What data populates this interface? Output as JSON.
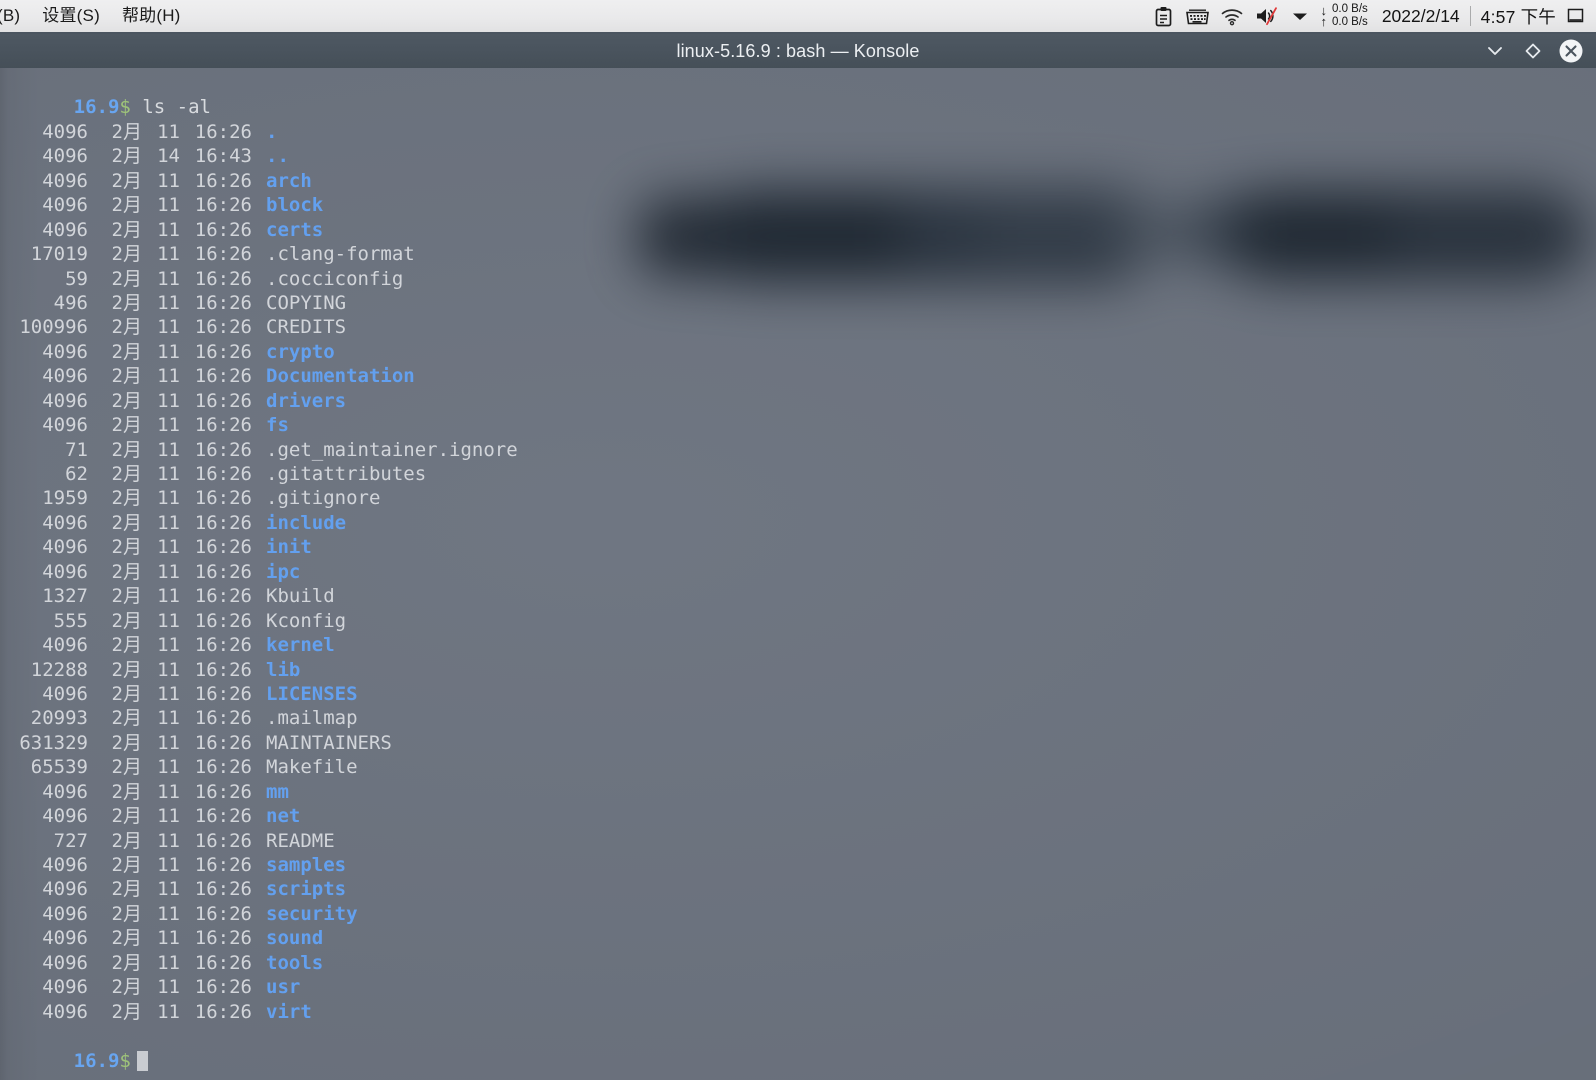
{
  "panel": {
    "menu_items": [
      {
        "label": "(B)",
        "name": "menu-bookmarks"
      },
      {
        "label": "设置(S)",
        "name": "menu-settings"
      },
      {
        "label": "帮助(H)",
        "name": "menu-help"
      }
    ],
    "tray_icons": [
      {
        "name": "clipboard-icon"
      },
      {
        "name": "keyboard-icon"
      },
      {
        "name": "wifi-icon"
      },
      {
        "name": "volume-muted-icon"
      },
      {
        "name": "chevron-down-icon"
      }
    ],
    "network": {
      "download_label": "0.0 B/s",
      "upload_label": "0.0 B/s",
      "down_arrow": "↓",
      "up_arrow": "↑"
    },
    "clock": {
      "date": "2022/2/14",
      "time": "4:57 下午"
    },
    "show_desktop_name": "show-desktop-icon"
  },
  "window": {
    "title": "linux-5.16.9 : bash — Konsole",
    "buttons": [
      {
        "name": "minimize-button",
        "glyph": "⌄"
      },
      {
        "name": "maximize-button",
        "glyph": "◇"
      },
      {
        "name": "close-button",
        "glyph": "✕"
      }
    ]
  },
  "terminal": {
    "prompt_host": "16.9",
    "prompt_symbol": "$",
    "command": "ls -al",
    "colors": {
      "background": "#6c737f",
      "foreground": "#d2d5da",
      "directory": "#63a0ef",
      "host": "#68a5f0",
      "dollar": "#9ec37a"
    },
    "listing": [
      {
        "size": "4096",
        "month": "2月",
        "day": "11",
        "time": "16:26",
        "name": ".",
        "type": "dir"
      },
      {
        "size": "4096",
        "month": "2月",
        "day": "14",
        "time": "16:43",
        "name": "..",
        "type": "dir"
      },
      {
        "size": "4096",
        "month": "2月",
        "day": "11",
        "time": "16:26",
        "name": "arch",
        "type": "dir"
      },
      {
        "size": "4096",
        "month": "2月",
        "day": "11",
        "time": "16:26",
        "name": "block",
        "type": "dir"
      },
      {
        "size": "4096",
        "month": "2月",
        "day": "11",
        "time": "16:26",
        "name": "certs",
        "type": "dir"
      },
      {
        "size": "17019",
        "month": "2月",
        "day": "11",
        "time": "16:26",
        "name": ".clang-format",
        "type": "file"
      },
      {
        "size": "59",
        "month": "2月",
        "day": "11",
        "time": "16:26",
        "name": ".cocciconfig",
        "type": "file"
      },
      {
        "size": "496",
        "month": "2月",
        "day": "11",
        "time": "16:26",
        "name": "COPYING",
        "type": "file"
      },
      {
        "size": "100996",
        "month": "2月",
        "day": "11",
        "time": "16:26",
        "name": "CREDITS",
        "type": "file"
      },
      {
        "size": "4096",
        "month": "2月",
        "day": "11",
        "time": "16:26",
        "name": "crypto",
        "type": "dir"
      },
      {
        "size": "4096",
        "month": "2月",
        "day": "11",
        "time": "16:26",
        "name": "Documentation",
        "type": "dir"
      },
      {
        "size": "4096",
        "month": "2月",
        "day": "11",
        "time": "16:26",
        "name": "drivers",
        "type": "dir"
      },
      {
        "size": "4096",
        "month": "2月",
        "day": "11",
        "time": "16:26",
        "name": "fs",
        "type": "dir"
      },
      {
        "size": "71",
        "month": "2月",
        "day": "11",
        "time": "16:26",
        "name": ".get_maintainer.ignore",
        "type": "file"
      },
      {
        "size": "62",
        "month": "2月",
        "day": "11",
        "time": "16:26",
        "name": ".gitattributes",
        "type": "file"
      },
      {
        "size": "1959",
        "month": "2月",
        "day": "11",
        "time": "16:26",
        "name": ".gitignore",
        "type": "file"
      },
      {
        "size": "4096",
        "month": "2月",
        "day": "11",
        "time": "16:26",
        "name": "include",
        "type": "dir"
      },
      {
        "size": "4096",
        "month": "2月",
        "day": "11",
        "time": "16:26",
        "name": "init",
        "type": "dir"
      },
      {
        "size": "4096",
        "month": "2月",
        "day": "11",
        "time": "16:26",
        "name": "ipc",
        "type": "dir"
      },
      {
        "size": "1327",
        "month": "2月",
        "day": "11",
        "time": "16:26",
        "name": "Kbuild",
        "type": "file"
      },
      {
        "size": "555",
        "month": "2月",
        "day": "11",
        "time": "16:26",
        "name": "Kconfig",
        "type": "file"
      },
      {
        "size": "4096",
        "month": "2月",
        "day": "11",
        "time": "16:26",
        "name": "kernel",
        "type": "dir"
      },
      {
        "size": "12288",
        "month": "2月",
        "day": "11",
        "time": "16:26",
        "name": "lib",
        "type": "dir"
      },
      {
        "size": "4096",
        "month": "2月",
        "day": "11",
        "time": "16:26",
        "name": "LICENSES",
        "type": "dir"
      },
      {
        "size": "20993",
        "month": "2月",
        "day": "11",
        "time": "16:26",
        "name": ".mailmap",
        "type": "file"
      },
      {
        "size": "631329",
        "month": "2月",
        "day": "11",
        "time": "16:26",
        "name": "MAINTAINERS",
        "type": "file"
      },
      {
        "size": "65539",
        "month": "2月",
        "day": "11",
        "time": "16:26",
        "name": "Makefile",
        "type": "file"
      },
      {
        "size": "4096",
        "month": "2月",
        "day": "11",
        "time": "16:26",
        "name": "mm",
        "type": "dir"
      },
      {
        "size": "4096",
        "month": "2月",
        "day": "11",
        "time": "16:26",
        "name": "net",
        "type": "dir"
      },
      {
        "size": "727",
        "month": "2月",
        "day": "11",
        "time": "16:26",
        "name": "README",
        "type": "file"
      },
      {
        "size": "4096",
        "month": "2月",
        "day": "11",
        "time": "16:26",
        "name": "samples",
        "type": "dir"
      },
      {
        "size": "4096",
        "month": "2月",
        "day": "11",
        "time": "16:26",
        "name": "scripts",
        "type": "dir"
      },
      {
        "size": "4096",
        "month": "2月",
        "day": "11",
        "time": "16:26",
        "name": "security",
        "type": "dir"
      },
      {
        "size": "4096",
        "month": "2月",
        "day": "11",
        "time": "16:26",
        "name": "sound",
        "type": "dir"
      },
      {
        "size": "4096",
        "month": "2月",
        "day": "11",
        "time": "16:26",
        "name": "tools",
        "type": "dir"
      },
      {
        "size": "4096",
        "month": "2月",
        "day": "11",
        "time": "16:26",
        "name": "usr",
        "type": "dir"
      },
      {
        "size": "4096",
        "month": "2月",
        "day": "11",
        "time": "16:26",
        "name": "virt",
        "type": "dir"
      }
    ]
  }
}
